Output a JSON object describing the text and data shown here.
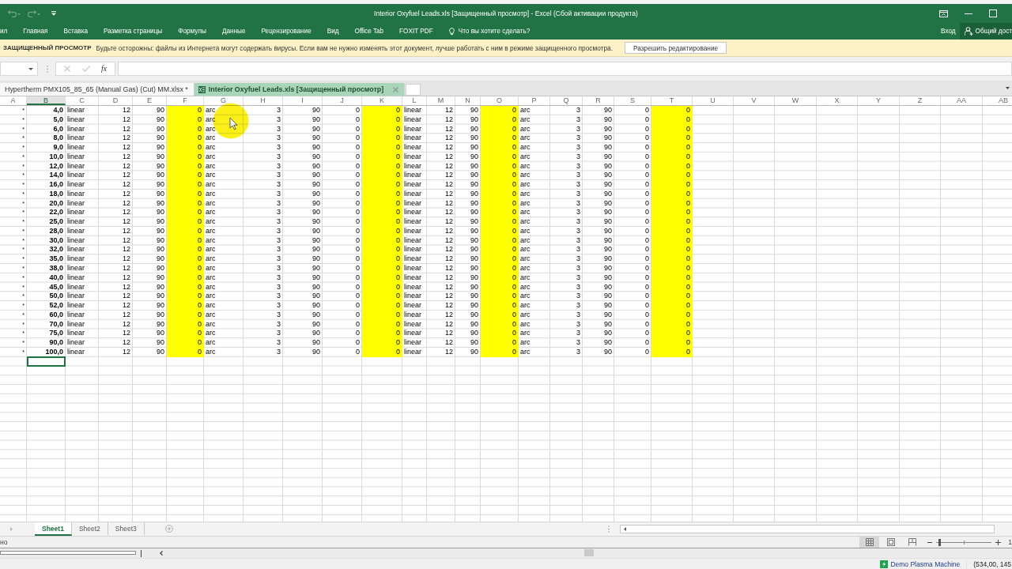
{
  "window": {
    "title": "Interior Oxyfuel Leads.xls [Защищенный просмотр] - Excel (Сбой активации продукта)"
  },
  "quick_access": [
    {
      "kind": "undo",
      "disabled": true
    },
    {
      "kind": "redo",
      "disabled": true
    },
    {
      "kind": "customize",
      "disabled": false
    }
  ],
  "ribbon": {
    "tabs": [
      {
        "label": "ил",
        "selected": false
      },
      {
        "label": "Главная",
        "selected": false
      },
      {
        "label": "Вставка",
        "selected": false
      },
      {
        "label": "Разметка страницы",
        "selected": false
      },
      {
        "label": "Формулы",
        "selected": false
      },
      {
        "label": "Данные",
        "selected": false
      },
      {
        "label": "Рецензирование",
        "selected": false
      },
      {
        "label": "Вид",
        "selected": false
      },
      {
        "label": "Office Tab",
        "selected": false
      },
      {
        "label": "FOXIT PDF",
        "selected": false
      }
    ],
    "search": "Что вы хотите сделать?",
    "sign_in": "Вход",
    "share": "Общий дост"
  },
  "protected_view": {
    "title": "ЗАЩИЩЕННЫЙ ПРОСМОТР",
    "message": "Будьте осторожны: файлы из Интернета могут содержать вирусы. Если вам не нужно изменять этот документ, лучше работать с ним в режиме защищенного просмотра.",
    "button": "Разрешить редактирование"
  },
  "formula_bar": {
    "buttons": [
      {
        "kind": "cancel",
        "disabled": true
      },
      {
        "kind": "enter",
        "disabled": true
      }
    ],
    "function_label": "fx"
  },
  "document_tabs": [
    {
      "label": "Hypertherm PMX105_85_65 (Manual Gas) (Cut) MM.xlsx *",
      "selected": false
    },
    {
      "label": "Interior Oxyfuel Leads.xls [Защищенный просмотр]",
      "selected": true
    }
  ],
  "sheet": {
    "columns": [
      {
        "label": "A",
        "kind": "marker",
        "bold": false,
        "highlighted": false,
        "selected": false
      },
      {
        "label": "B",
        "kind": "number",
        "bold": true,
        "highlighted": false,
        "selected": true
      },
      {
        "label": "C",
        "kind": "text",
        "bold": false,
        "highlighted": false,
        "selected": false
      },
      {
        "label": "D",
        "kind": "number",
        "bold": false,
        "highlighted": false,
        "selected": false
      },
      {
        "label": "E",
        "kind": "number",
        "bold": false,
        "highlighted": false,
        "selected": false
      },
      {
        "label": "F",
        "kind": "number",
        "bold": false,
        "highlighted": true,
        "selected": false
      },
      {
        "label": "G",
        "kind": "text",
        "bold": false,
        "highlighted": false,
        "selected": false
      },
      {
        "label": "H",
        "kind": "number",
        "bold": false,
        "highlighted": false,
        "selected": false
      },
      {
        "label": "I",
        "kind": "number",
        "bold": false,
        "highlighted": false,
        "selected": false
      },
      {
        "label": "J",
        "kind": "number",
        "bold": false,
        "highlighted": false,
        "selected": false
      },
      {
        "label": "K",
        "kind": "number",
        "bold": false,
        "highlighted": true,
        "selected": false
      },
      {
        "label": "L",
        "kind": "text",
        "bold": false,
        "highlighted": false,
        "selected": false
      },
      {
        "label": "M",
        "kind": "number",
        "bold": false,
        "highlighted": false,
        "selected": false
      },
      {
        "label": "N",
        "kind": "number",
        "bold": false,
        "highlighted": false,
        "selected": false
      },
      {
        "label": "O",
        "kind": "number",
        "bold": false,
        "highlighted": true,
        "selected": false
      },
      {
        "label": "P",
        "kind": "text",
        "bold": false,
        "highlighted": false,
        "selected": false
      },
      {
        "label": "Q",
        "kind": "number",
        "bold": false,
        "highlighted": false,
        "selected": false
      },
      {
        "label": "R",
        "kind": "number",
        "bold": false,
        "highlighted": false,
        "selected": false
      },
      {
        "label": "S",
        "kind": "number",
        "bold": false,
        "highlighted": false,
        "selected": false
      },
      {
        "label": "T",
        "kind": "number",
        "bold": false,
        "highlighted": true,
        "selected": false
      },
      {
        "label": "U",
        "highlighted": false,
        "selected": false
      },
      {
        "label": "V",
        "highlighted": false,
        "selected": false
      },
      {
        "label": "W",
        "highlighted": false,
        "selected": false
      },
      {
        "label": "X",
        "highlighted": false,
        "selected": false
      },
      {
        "label": "Y",
        "highlighted": false,
        "selected": false
      },
      {
        "label": "Z",
        "highlighted": false,
        "selected": false
      },
      {
        "label": "AA",
        "highlighted": false,
        "selected": false
      },
      {
        "label": "AB",
        "highlighted": false,
        "selected": false
      }
    ],
    "rows": [
      [
        "*",
        "4,0",
        "linear",
        "12",
        "90",
        "0",
        "arc",
        "3",
        "90",
        "0",
        "0",
        "linear",
        "12",
        "90",
        "0",
        "arc",
        "3",
        "90",
        "0",
        "0"
      ],
      [
        "*",
        "5,0",
        "linear",
        "12",
        "90",
        "0",
        "arc",
        "3",
        "90",
        "0",
        "0",
        "linear",
        "12",
        "90",
        "0",
        "arc",
        "3",
        "90",
        "0",
        "0"
      ],
      [
        "*",
        "6,0",
        "linear",
        "12",
        "90",
        "0",
        "arc",
        "3",
        "90",
        "0",
        "0",
        "linear",
        "12",
        "90",
        "0",
        "arc",
        "3",
        "90",
        "0",
        "0"
      ],
      [
        "*",
        "8,0",
        "linear",
        "12",
        "90",
        "0",
        "arc",
        "3",
        "90",
        "0",
        "0",
        "linear",
        "12",
        "90",
        "0",
        "arc",
        "3",
        "90",
        "0",
        "0"
      ],
      [
        "*",
        "9,0",
        "linear",
        "12",
        "90",
        "0",
        "arc",
        "3",
        "90",
        "0",
        "0",
        "linear",
        "12",
        "90",
        "0",
        "arc",
        "3",
        "90",
        "0",
        "0"
      ],
      [
        "*",
        "10,0",
        "linear",
        "12",
        "90",
        "0",
        "arc",
        "3",
        "90",
        "0",
        "0",
        "linear",
        "12",
        "90",
        "0",
        "arc",
        "3",
        "90",
        "0",
        "0"
      ],
      [
        "*",
        "12,0",
        "linear",
        "12",
        "90",
        "0",
        "arc",
        "3",
        "90",
        "0",
        "0",
        "linear",
        "12",
        "90",
        "0",
        "arc",
        "3",
        "90",
        "0",
        "0"
      ],
      [
        "*",
        "14,0",
        "linear",
        "12",
        "90",
        "0",
        "arc",
        "3",
        "90",
        "0",
        "0",
        "linear",
        "12",
        "90",
        "0",
        "arc",
        "3",
        "90",
        "0",
        "0"
      ],
      [
        "*",
        "16,0",
        "linear",
        "12",
        "90",
        "0",
        "arc",
        "3",
        "90",
        "0",
        "0",
        "linear",
        "12",
        "90",
        "0",
        "arc",
        "3",
        "90",
        "0",
        "0"
      ],
      [
        "*",
        "18,0",
        "linear",
        "12",
        "90",
        "0",
        "arc",
        "3",
        "90",
        "0",
        "0",
        "linear",
        "12",
        "90",
        "0",
        "arc",
        "3",
        "90",
        "0",
        "0"
      ],
      [
        "*",
        "20,0",
        "linear",
        "12",
        "90",
        "0",
        "arc",
        "3",
        "90",
        "0",
        "0",
        "linear",
        "12",
        "90",
        "0",
        "arc",
        "3",
        "90",
        "0",
        "0"
      ],
      [
        "*",
        "22,0",
        "linear",
        "12",
        "90",
        "0",
        "arc",
        "3",
        "90",
        "0",
        "0",
        "linear",
        "12",
        "90",
        "0",
        "arc",
        "3",
        "90",
        "0",
        "0"
      ],
      [
        "*",
        "25,0",
        "linear",
        "12",
        "90",
        "0",
        "arc",
        "3",
        "90",
        "0",
        "0",
        "linear",
        "12",
        "90",
        "0",
        "arc",
        "3",
        "90",
        "0",
        "0"
      ],
      [
        "*",
        "28,0",
        "linear",
        "12",
        "90",
        "0",
        "arc",
        "3",
        "90",
        "0",
        "0",
        "linear",
        "12",
        "90",
        "0",
        "arc",
        "3",
        "90",
        "0",
        "0"
      ],
      [
        "*",
        "30,0",
        "linear",
        "12",
        "90",
        "0",
        "arc",
        "3",
        "90",
        "0",
        "0",
        "linear",
        "12",
        "90",
        "0",
        "arc",
        "3",
        "90",
        "0",
        "0"
      ],
      [
        "*",
        "32,0",
        "linear",
        "12",
        "90",
        "0",
        "arc",
        "3",
        "90",
        "0",
        "0",
        "linear",
        "12",
        "90",
        "0",
        "arc",
        "3",
        "90",
        "0",
        "0"
      ],
      [
        "*",
        "35,0",
        "linear",
        "12",
        "90",
        "0",
        "arc",
        "3",
        "90",
        "0",
        "0",
        "linear",
        "12",
        "90",
        "0",
        "arc",
        "3",
        "90",
        "0",
        "0"
      ],
      [
        "*",
        "38,0",
        "linear",
        "12",
        "90",
        "0",
        "arc",
        "3",
        "90",
        "0",
        "0",
        "linear",
        "12",
        "90",
        "0",
        "arc",
        "3",
        "90",
        "0",
        "0"
      ],
      [
        "*",
        "40,0",
        "linear",
        "12",
        "90",
        "0",
        "arc",
        "3",
        "90",
        "0",
        "0",
        "linear",
        "12",
        "90",
        "0",
        "arc",
        "3",
        "90",
        "0",
        "0"
      ],
      [
        "*",
        "45,0",
        "linear",
        "12",
        "90",
        "0",
        "arc",
        "3",
        "90",
        "0",
        "0",
        "linear",
        "12",
        "90",
        "0",
        "arc",
        "3",
        "90",
        "0",
        "0"
      ],
      [
        "*",
        "50,0",
        "linear",
        "12",
        "90",
        "0",
        "arc",
        "3",
        "90",
        "0",
        "0",
        "linear",
        "12",
        "90",
        "0",
        "arc",
        "3",
        "90",
        "0",
        "0"
      ],
      [
        "*",
        "52,0",
        "linear",
        "12",
        "90",
        "0",
        "arc",
        "3",
        "90",
        "0",
        "0",
        "linear",
        "12",
        "90",
        "0",
        "arc",
        "3",
        "90",
        "0",
        "0"
      ],
      [
        "*",
        "60,0",
        "linear",
        "12",
        "90",
        "0",
        "arc",
        "3",
        "90",
        "0",
        "0",
        "linear",
        "12",
        "90",
        "0",
        "arc",
        "3",
        "90",
        "0",
        "0"
      ],
      [
        "*",
        "70,0",
        "linear",
        "12",
        "90",
        "0",
        "arc",
        "3",
        "90",
        "0",
        "0",
        "linear",
        "12",
        "90",
        "0",
        "arc",
        "3",
        "90",
        "0",
        "0"
      ],
      [
        "*",
        "75,0",
        "linear",
        "12",
        "90",
        "0",
        "arc",
        "3",
        "90",
        "0",
        "0",
        "linear",
        "12",
        "90",
        "0",
        "arc",
        "3",
        "90",
        "0",
        "0"
      ],
      [
        "*",
        "90,0",
        "linear",
        "12",
        "90",
        "0",
        "arc",
        "3",
        "90",
        "0",
        "0",
        "linear",
        "12",
        "90",
        "0",
        "arc",
        "3",
        "90",
        "0",
        "0"
      ],
      [
        "*",
        "100,0",
        "linear",
        "12",
        "90",
        "0",
        "arc",
        "3",
        "90",
        "0",
        "0",
        "linear",
        "12",
        "90",
        "0",
        "arc",
        "3",
        "90",
        "0",
        "0"
      ]
    ]
  },
  "sheet_tabs": [
    {
      "label": "Sheet1",
      "selected": true
    },
    {
      "label": "Sheet2",
      "selected": false
    },
    {
      "label": "Sheet3",
      "selected": false
    }
  ],
  "status_bar": {
    "text": "но",
    "views": [
      {
        "kind": "normal",
        "selected": true
      },
      {
        "kind": "page-layout",
        "selected": false
      },
      {
        "kind": "page-break",
        "selected": false
      }
    ],
    "zoom": {
      "level": 0.05
    },
    "zoom_label": "1"
  },
  "taskbar": {
    "app": "Demo Plasma Machine",
    "coordinates": "(534,00, 145"
  }
}
